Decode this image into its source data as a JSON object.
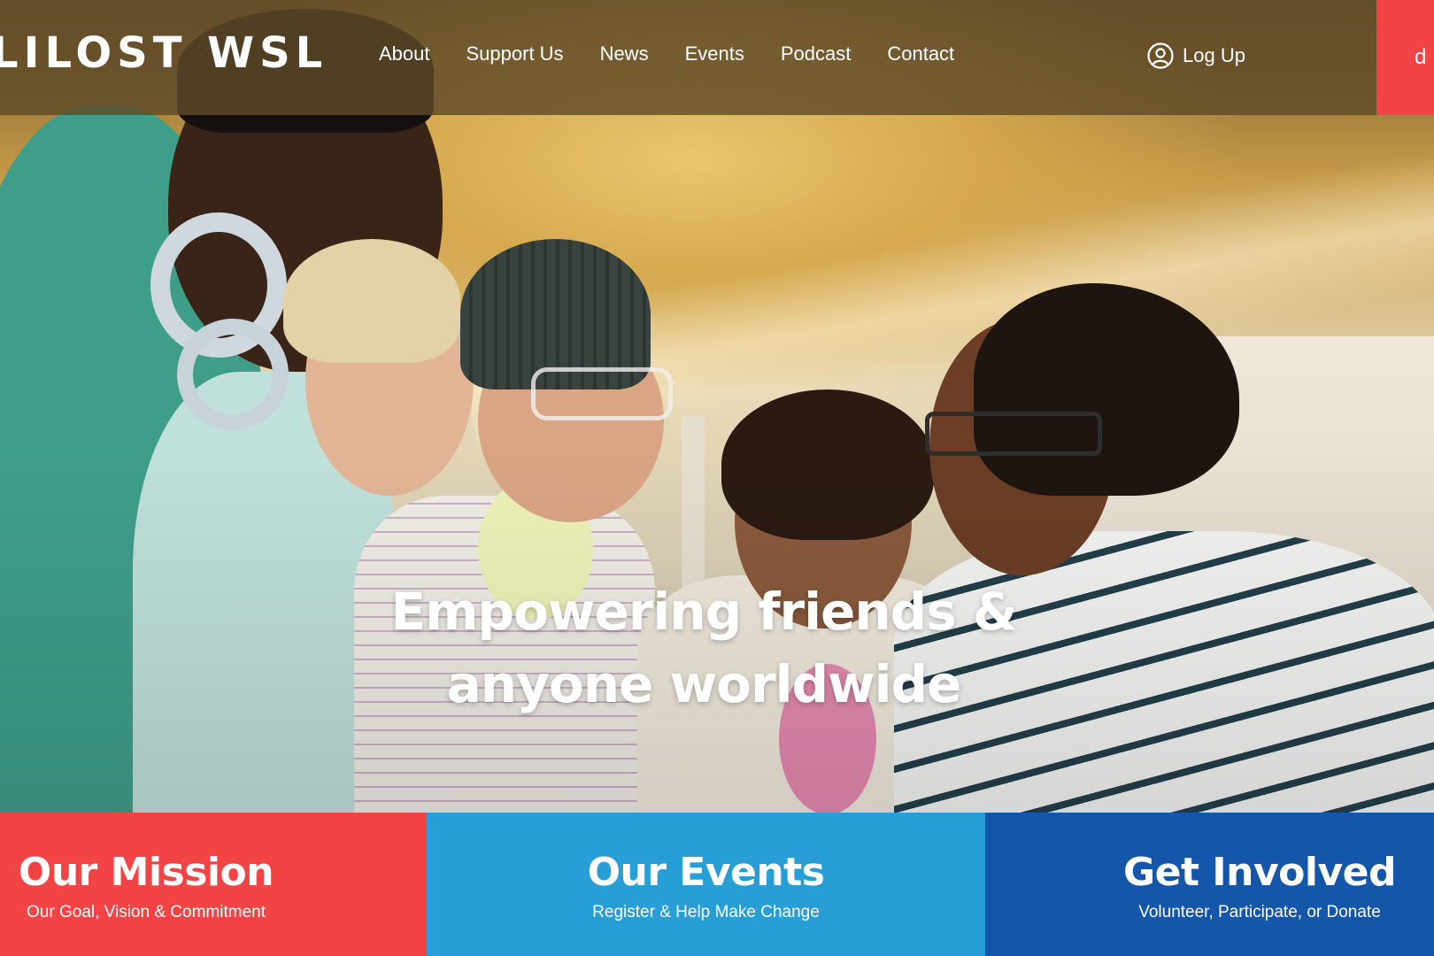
{
  "site": {
    "logo_text": "LILOST WSL"
  },
  "nav": {
    "items": [
      {
        "label": "About"
      },
      {
        "label": "Support Us"
      },
      {
        "label": "News"
      },
      {
        "label": "Events"
      },
      {
        "label": "Podcast"
      },
      {
        "label": "Contact"
      }
    ],
    "login_label": "Log Up",
    "login_icon": "user-circle-icon",
    "donate_label": "d"
  },
  "hero": {
    "headline_line1": "Empowering friends &",
    "headline_line2": "anyone worldwide"
  },
  "tiles": [
    {
      "title": "Our Mission",
      "subtitle": "Our Goal, Vision & Commitment",
      "color": "#f24444"
    },
    {
      "title": "Our Events",
      "subtitle": "Register & Help Make Change",
      "color": "#279ed6"
    },
    {
      "title": "Get Involved",
      "subtitle": "Volunteer, Participate, or Donate",
      "color": "#1456a9"
    }
  ],
  "colors": {
    "accent_red": "#f24444",
    "accent_light_blue": "#279ed6",
    "accent_dark_blue": "#1456a9",
    "header_overlay": "#5f4b28"
  }
}
